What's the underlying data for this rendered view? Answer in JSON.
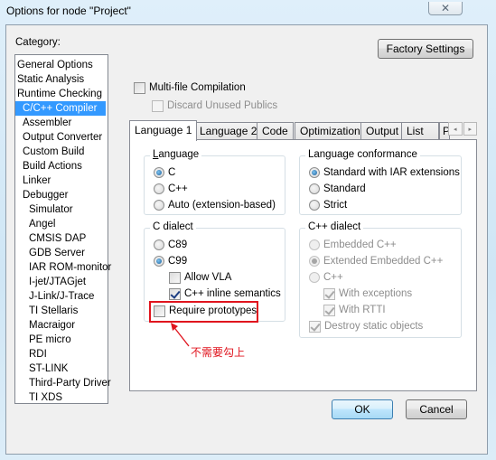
{
  "window": {
    "title": "Options for node \"Project\"",
    "close_icon": "close-x-icon"
  },
  "category": {
    "label": "Category:",
    "selected": "C/C++ Compiler",
    "items": [
      {
        "label": "General Options",
        "level": 0
      },
      {
        "label": "Static Analysis",
        "level": 0
      },
      {
        "label": "Runtime Checking",
        "level": 0
      },
      {
        "label": "C/C++ Compiler",
        "level": 1
      },
      {
        "label": "Assembler",
        "level": 1
      },
      {
        "label": "Output Converter",
        "level": 1
      },
      {
        "label": "Custom Build",
        "level": 1
      },
      {
        "label": "Build Actions",
        "level": 1
      },
      {
        "label": "Linker",
        "level": 1
      },
      {
        "label": "Debugger",
        "level": 1
      },
      {
        "label": "Simulator",
        "level": 2
      },
      {
        "label": "Angel",
        "level": 2
      },
      {
        "label": "CMSIS DAP",
        "level": 2
      },
      {
        "label": "GDB Server",
        "level": 2
      },
      {
        "label": "IAR ROM-monitor",
        "level": 2
      },
      {
        "label": "I-jet/JTAGjet",
        "level": 2
      },
      {
        "label": "J-Link/J-Trace",
        "level": 2
      },
      {
        "label": "TI Stellaris",
        "level": 2
      },
      {
        "label": "Macraigor",
        "level": 2
      },
      {
        "label": "PE micro",
        "level": 2
      },
      {
        "label": "RDI",
        "level": 2
      },
      {
        "label": "ST-LINK",
        "level": 2
      },
      {
        "label": "Third-Party Driver",
        "level": 2
      },
      {
        "label": "TI XDS",
        "level": 2
      }
    ]
  },
  "top": {
    "factory_settings": "Factory Settings",
    "multi_file": {
      "label": "Multi-file Compilation",
      "checked": false
    },
    "discard_unused": {
      "label": "Discard Unused Publics",
      "checked": false,
      "disabled": true
    }
  },
  "tabs": {
    "items": [
      "Language 1",
      "Language 2",
      "Code",
      "Optimizations",
      "Output",
      "List",
      "P"
    ],
    "active": "Language 1",
    "scroll_left": "◂",
    "scroll_right": "▸"
  },
  "language": {
    "title": "Language",
    "options": [
      {
        "label": "C",
        "checked": true
      },
      {
        "label": "C++",
        "checked": false
      },
      {
        "label": "Auto (extension-based)",
        "checked": false
      }
    ]
  },
  "conformance": {
    "title": "Language conformance",
    "options": [
      {
        "label": "Standard with IAR extensions",
        "checked": true
      },
      {
        "label": "Standard",
        "checked": false
      },
      {
        "label": "Strict",
        "checked": false
      }
    ]
  },
  "c_dialect": {
    "title": "C dialect",
    "options": [
      {
        "label": "C89",
        "checked": false
      },
      {
        "label": "C99",
        "checked": true
      }
    ],
    "allow_vla": {
      "label": "Allow VLA",
      "checked": false
    },
    "cpp_inline": {
      "label": "C++ inline semantics",
      "checked": true
    },
    "require_prototypes": {
      "label": "Require prototypes",
      "checked": false
    }
  },
  "cpp_dialect": {
    "title": "C++ dialect",
    "options": [
      {
        "label": "Embedded C++",
        "checked": false
      },
      {
        "label": "Extended Embedded C++",
        "checked": true
      },
      {
        "label": "C++",
        "checked": false
      }
    ],
    "with_exceptions": {
      "label": "With exceptions",
      "checked": true
    },
    "with_rtti": {
      "label": "With RTTI",
      "checked": true
    },
    "destroy_static": {
      "label": "Destroy static objects",
      "checked": true
    }
  },
  "annotation": {
    "text": "不需要勾上",
    "color": "#e0141e"
  },
  "footer": {
    "ok": "OK",
    "cancel": "Cancel"
  }
}
